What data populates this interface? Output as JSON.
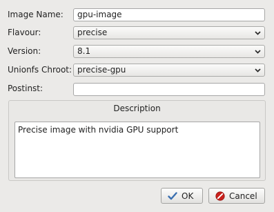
{
  "form": {
    "image_name": {
      "label": "Image Name:",
      "value": "gpu-image"
    },
    "flavour": {
      "label": "Flavour:",
      "value": "precise"
    },
    "version": {
      "label": "Version:",
      "value": "8.1"
    },
    "unionfs_chroot": {
      "label": "Unionfs Chroot:",
      "value": "precise-gpu"
    },
    "postinst": {
      "label": "Postinst:",
      "value": ""
    }
  },
  "description": {
    "title": "Description",
    "text": "Precise image with nvidia GPU support"
  },
  "buttons": {
    "ok": {
      "label": "OK",
      "icon": "checkmark-icon",
      "color": "#3a6fb0"
    },
    "cancel": {
      "label": "Cancel",
      "icon": "cancel-icon",
      "color": "#c9201c"
    }
  }
}
